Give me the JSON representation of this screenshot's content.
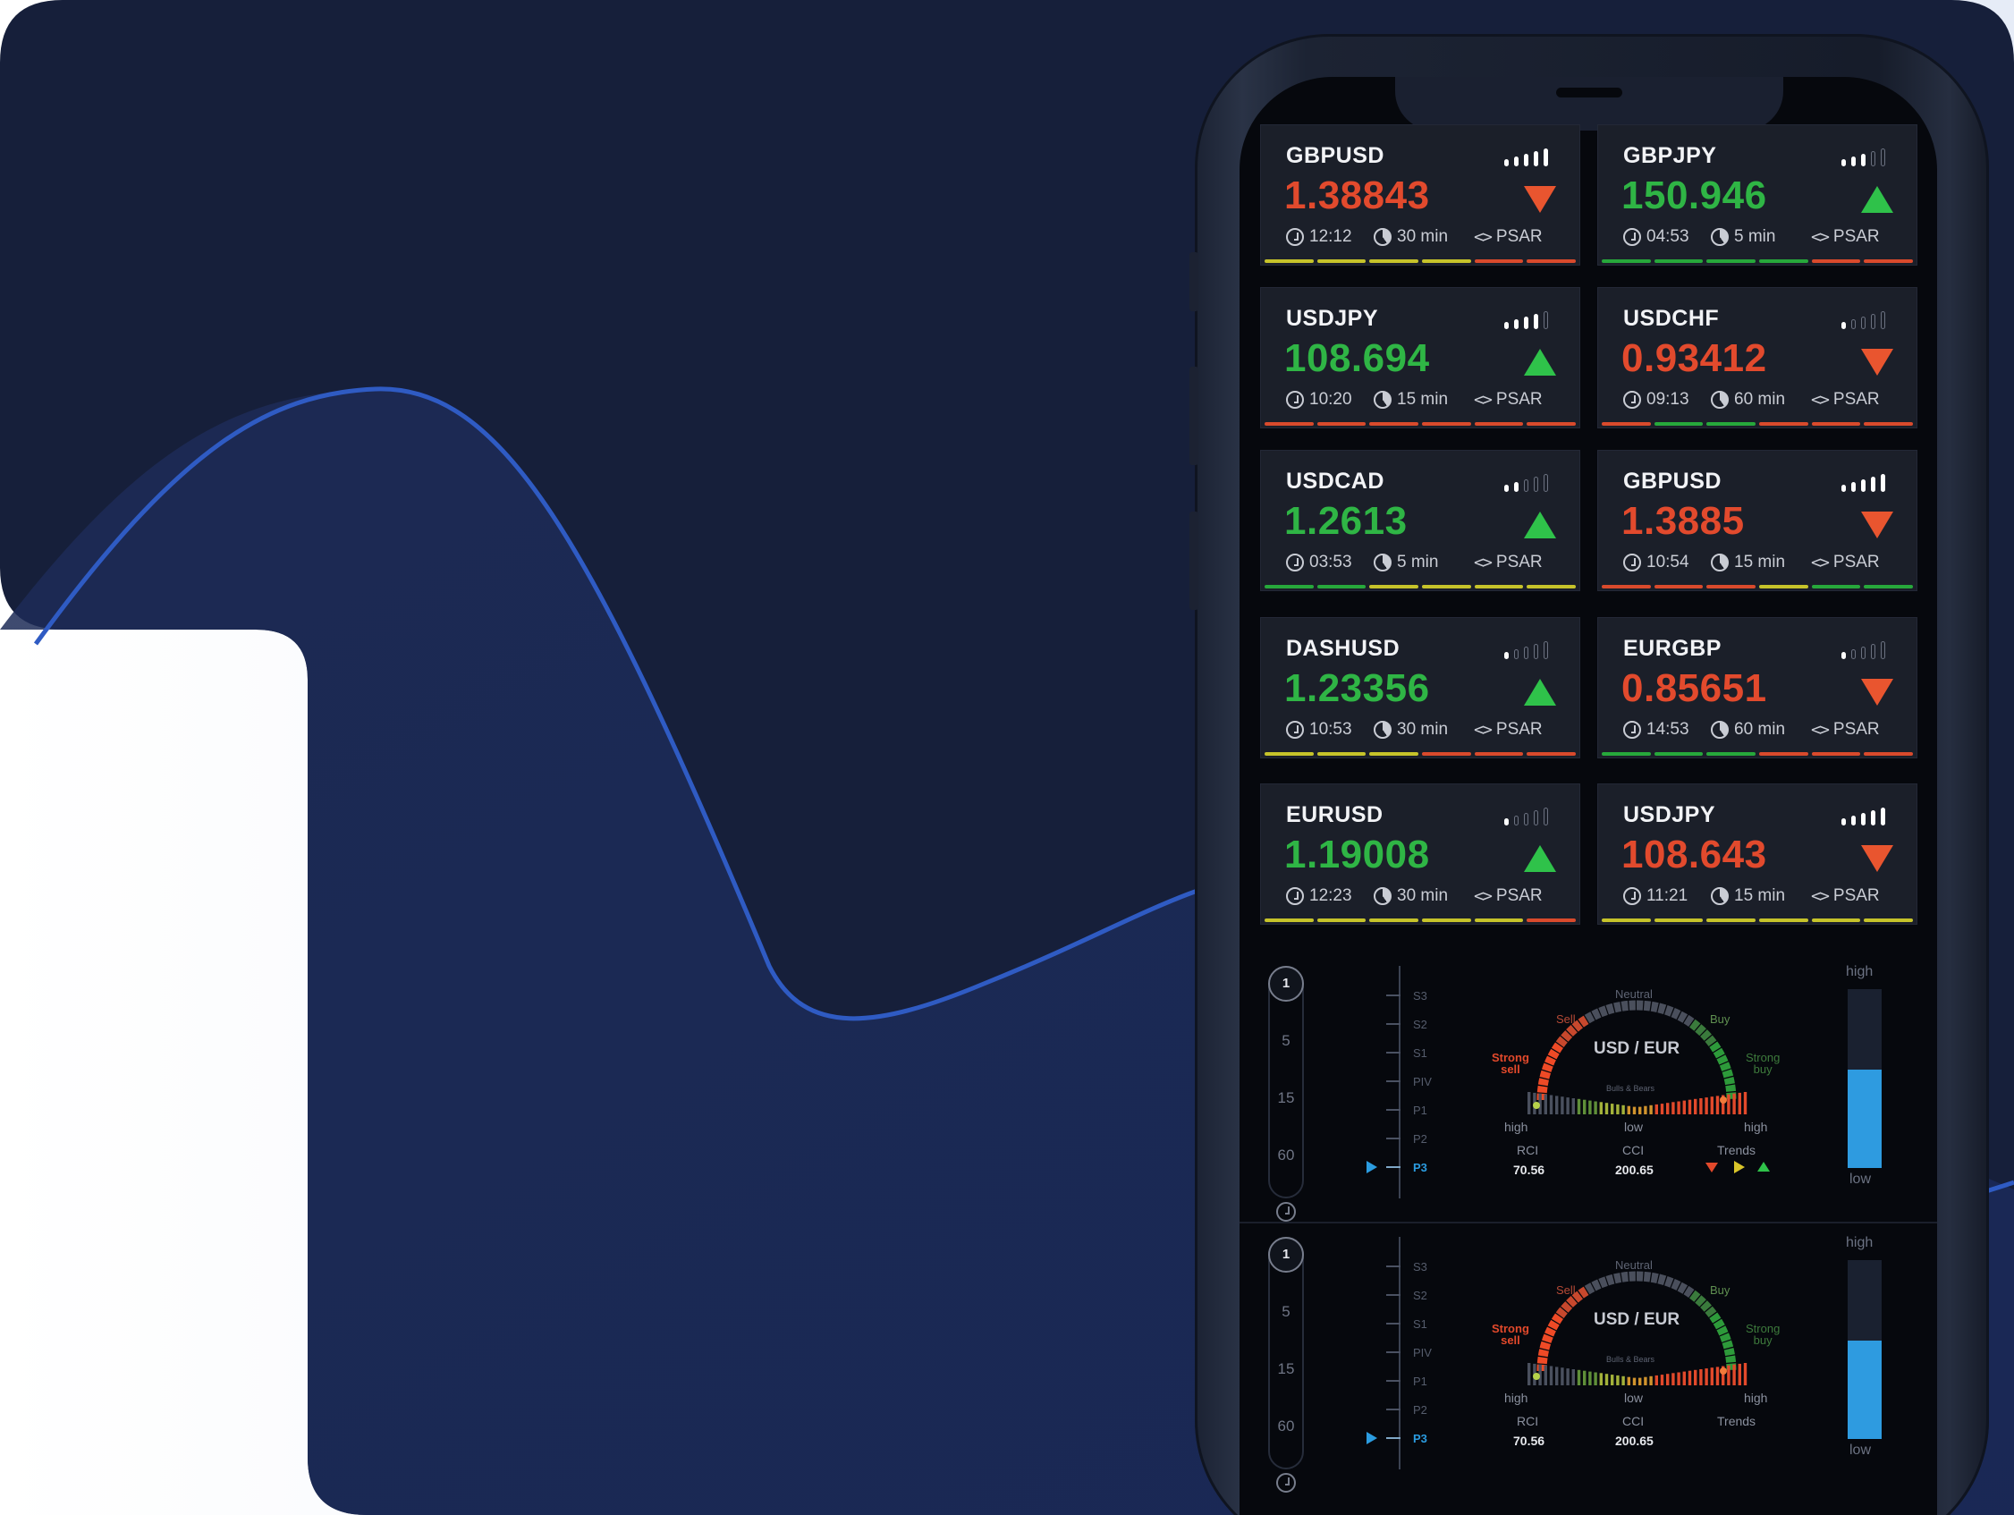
{
  "colors": {
    "bg_dark": "#161f38",
    "up": "#2fb545",
    "down": "#e24a2d",
    "accent": "#2e9be0"
  },
  "cards": [
    {
      "pair": "GBPUSD",
      "price": "1.38843",
      "direction": "down",
      "signal": 5,
      "time": "12:12",
      "interval": "30 min",
      "indicator": "PSAR",
      "strip": [
        "#c6c32a",
        "#c6c32a",
        "#c6c32a",
        "#c6c32a",
        "#d94a2c",
        "#d94a2c"
      ]
    },
    {
      "pair": "GBPJPY",
      "price": "150.946",
      "direction": "up",
      "signal": 3,
      "time": "04:53",
      "interval": "5 min",
      "indicator": "PSAR",
      "strip": [
        "#27a83b",
        "#27a83b",
        "#27a83b",
        "#27a83b",
        "#d94a2c",
        "#d94a2c"
      ]
    },
    {
      "pair": "USDJPY",
      "price": "108.694",
      "direction": "up",
      "signal": 4,
      "time": "10:20",
      "interval": "15 min",
      "indicator": "PSAR",
      "strip": [
        "#d94a2c",
        "#d94a2c",
        "#d94a2c",
        "#d94a2c",
        "#d94a2c",
        "#d94a2c"
      ]
    },
    {
      "pair": "USDCHF",
      "price": "0.93412",
      "direction": "down",
      "signal": 1,
      "time": "09:13",
      "interval": "60 min",
      "indicator": "PSAR",
      "strip": [
        "#d94a2c",
        "#27a83b",
        "#27a83b",
        "#d94a2c",
        "#d94a2c",
        "#d94a2c"
      ]
    },
    {
      "pair": "USDCAD",
      "price": "1.2613",
      "direction": "up",
      "signal": 2,
      "time": "03:53",
      "interval": "5 min",
      "indicator": "PSAR",
      "strip": [
        "#27a83b",
        "#27a83b",
        "#c6c32a",
        "#c6c32a",
        "#c6c32a",
        "#c6c32a"
      ]
    },
    {
      "pair": "GBPUSD",
      "price": "1.3885",
      "direction": "down",
      "signal": 5,
      "time": "10:54",
      "interval": "15 min",
      "indicator": "PSAR",
      "strip": [
        "#d94a2c",
        "#d94a2c",
        "#d94a2c",
        "#c6c32a",
        "#27a83b",
        "#27a83b"
      ]
    },
    {
      "pair": "DASHUSD",
      "price": "1.23356",
      "direction": "up",
      "signal": 1,
      "time": "10:53",
      "interval": "30 min",
      "indicator": "PSAR",
      "strip": [
        "#c6c32a",
        "#c6c32a",
        "#c6c32a",
        "#d94a2c",
        "#d94a2c",
        "#d94a2c"
      ]
    },
    {
      "pair": "EURGBP",
      "price": "0.85651",
      "direction": "down",
      "signal": 1,
      "time": "14:53",
      "interval": "60 min",
      "indicator": "PSAR",
      "strip": [
        "#27a83b",
        "#27a83b",
        "#27a83b",
        "#d94a2c",
        "#d94a2c",
        "#d94a2c"
      ]
    },
    {
      "pair": "EURUSD",
      "price": "1.19008",
      "direction": "up",
      "signal": 1,
      "time": "12:23",
      "interval": "30 min",
      "indicator": "PSAR",
      "strip": [
        "#c6c32a",
        "#c6c32a",
        "#c6c32a",
        "#c6c32a",
        "#c6c32a",
        "#d94a2c"
      ]
    },
    {
      "pair": "USDJPY",
      "price": "108.643",
      "direction": "down",
      "signal": 5,
      "time": "11:21",
      "interval": "15 min",
      "indicator": "PSAR",
      "strip": [
        "#c6c32a",
        "#c6c32a",
        "#c6c32a",
        "#c6c32a",
        "#c6c32a",
        "#c6c32a"
      ]
    }
  ],
  "gauges": [
    {
      "timeframes": {
        "selected": "1",
        "options": [
          "5",
          "15",
          "60"
        ]
      },
      "pivots": [
        "S3",
        "S2",
        "S1",
        "PIV",
        "P1",
        "P2",
        "P3"
      ],
      "active_pivot": "P3",
      "title": "USD / EUR",
      "labels": {
        "neutral": "Neutral",
        "sell": "Sell",
        "buy": "Buy",
        "strong_sell_1": "Strong",
        "strong_sell_2": "sell",
        "strong_buy_1": "Strong",
        "strong_buy_2": "buy",
        "bulls": "Bulls & Bears",
        "high_left": "high",
        "low_mid": "low",
        "high_right": "high"
      },
      "rci_label": "RCI",
      "rci_value": "70.56",
      "cci_label": "CCI",
      "cci_value": "200.65",
      "trends_label": "Trends",
      "show_trend_icons": true,
      "vbar": {
        "high": "high",
        "low": "low",
        "level": 0.55
      }
    },
    {
      "timeframes": {
        "selected": "1",
        "options": [
          "5",
          "15",
          "60"
        ]
      },
      "pivots": [
        "S3",
        "S2",
        "S1",
        "PIV",
        "P1",
        "P2",
        "P3"
      ],
      "active_pivot": "P3",
      "title": "USD / EUR",
      "labels": {
        "neutral": "Neutral",
        "sell": "Sell",
        "buy": "Buy",
        "strong_sell_1": "Strong",
        "strong_sell_2": "sell",
        "strong_buy_1": "Strong",
        "strong_buy_2": "buy",
        "bulls": "Bulls & Bears",
        "high_left": "high",
        "low_mid": "low",
        "high_right": "high"
      },
      "rci_label": "RCI",
      "rci_value": "70.56",
      "cci_label": "CCI",
      "cci_value": "200.65",
      "trends_label": "Trends",
      "show_trend_icons": false,
      "vbar": {
        "high": "high",
        "low": "low",
        "level": 0.55
      }
    }
  ]
}
